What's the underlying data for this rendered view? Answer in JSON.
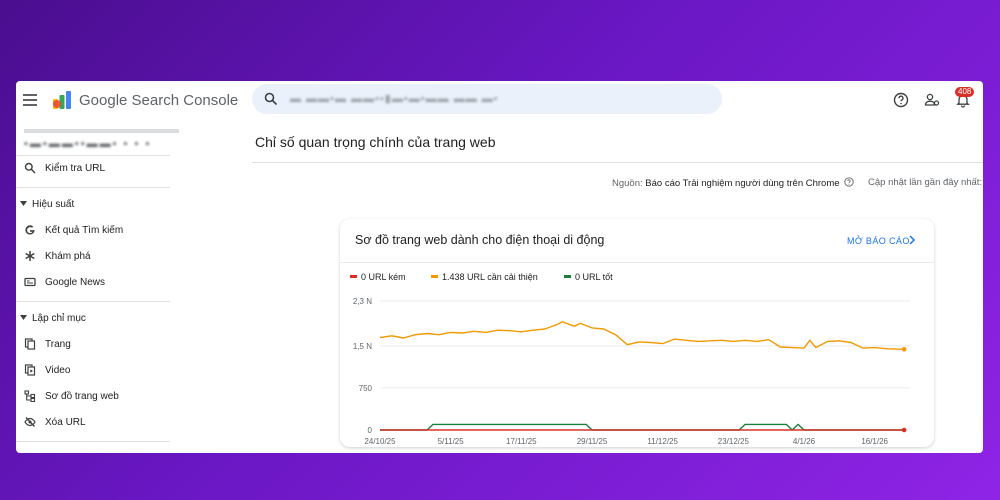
{
  "app": {
    "title": "Google Search Console",
    "search_value": "▬   ▬▬▪▬  ▬▬▪▪▮▬▪▬▪▬▬ ▬▬ ▬▪",
    "notification_count": "408"
  },
  "sidebar": {
    "site_name": "▪▬▪▬▬▪▪▬▬▪ ▪ ▪ ▪",
    "url_inspection": "Kiểm tra URL",
    "sections": {
      "performance": "Hiệu suất",
      "indexing": "Lập chỉ mục"
    },
    "items": {
      "search_results": "Kết quả Tìm kiếm",
      "discover": "Khám phá",
      "google_news": "Google News",
      "pages": "Trang",
      "video": "Video",
      "sitemaps": "Sơ đồ trang web",
      "removals": "Xóa URL"
    }
  },
  "main": {
    "page_title": "Chỉ số quan trọng chính của trang web",
    "source_label": "Nguồn:",
    "source_value": "Báo cáo Trải nghiệm người dùng trên Chrome",
    "updated_label": "Cập nhật lần gần đây nhất:"
  },
  "card": {
    "title": "Sơ đồ trang web dành cho điện thoại di động",
    "link": "MỞ BÁO CÁO"
  },
  "colors": {
    "poor": "#d93025",
    "needs_improvement": "#f29900",
    "good": "#188038",
    "accent": "#1a73e8"
  },
  "chart_data": {
    "type": "line",
    "x_ticks": [
      "24/10/25",
      "5/11/25",
      "17/11/25",
      "29/11/25",
      "11/12/25",
      "23/12/25",
      "4/1/26",
      "16/1/26"
    ],
    "y_ticks": [
      "0",
      "750",
      "1,5 N",
      "2,3 N"
    ],
    "ylim": [
      0,
      2300
    ],
    "x_range": [
      "2025-10-24",
      "2026-01-22"
    ],
    "legend": [
      "0 URL kém",
      "1.438 URL cần cải thiện",
      "0 URL tốt"
    ],
    "series": [
      {
        "name": "URL kém",
        "color": "#d93025",
        "points": [
          [
            "2025-10-24",
            0
          ],
          [
            "2026-01-21",
            0
          ]
        ]
      },
      {
        "name": "URL cần cải thiện",
        "color": "#f29900",
        "points": [
          [
            "2025-10-24",
            1650
          ],
          [
            "2025-10-26",
            1680
          ],
          [
            "2025-10-28",
            1640
          ],
          [
            "2025-10-30",
            1700
          ],
          [
            "2025-11-01",
            1720
          ],
          [
            "2025-11-03",
            1700
          ],
          [
            "2025-11-05",
            1740
          ],
          [
            "2025-11-07",
            1730
          ],
          [
            "2025-11-09",
            1760
          ],
          [
            "2025-11-11",
            1740
          ],
          [
            "2025-11-13",
            1780
          ],
          [
            "2025-11-15",
            1770
          ],
          [
            "2025-11-17",
            1750
          ],
          [
            "2025-11-19",
            1780
          ],
          [
            "2025-11-21",
            1800
          ],
          [
            "2025-11-23",
            1880
          ],
          [
            "2025-11-24",
            1930
          ],
          [
            "2025-11-26",
            1850
          ],
          [
            "2025-11-27",
            1900
          ],
          [
            "2025-11-29",
            1820
          ],
          [
            "2025-12-01",
            1800
          ],
          [
            "2025-12-03",
            1700
          ],
          [
            "2025-12-05",
            1520
          ],
          [
            "2025-12-07",
            1570
          ],
          [
            "2025-12-09",
            1560
          ],
          [
            "2025-12-11",
            1540
          ],
          [
            "2025-12-13",
            1620
          ],
          [
            "2025-12-15",
            1600
          ],
          [
            "2025-12-17",
            1580
          ],
          [
            "2025-12-19",
            1590
          ],
          [
            "2025-12-21",
            1600
          ],
          [
            "2025-12-23",
            1580
          ],
          [
            "2025-12-25",
            1600
          ],
          [
            "2025-12-27",
            1580
          ],
          [
            "2025-12-29",
            1610
          ],
          [
            "2025-12-31",
            1480
          ],
          [
            "2026-01-02",
            1470
          ],
          [
            "2026-01-04",
            1460
          ],
          [
            "2026-01-05",
            1600
          ],
          [
            "2026-01-06",
            1470
          ],
          [
            "2026-01-08",
            1580
          ],
          [
            "2026-01-10",
            1590
          ],
          [
            "2026-01-12",
            1560
          ],
          [
            "2026-01-14",
            1460
          ],
          [
            "2026-01-16",
            1470
          ],
          [
            "2026-01-18",
            1450
          ],
          [
            "2026-01-21",
            1438
          ]
        ]
      },
      {
        "name": "URL tốt",
        "color": "#188038",
        "points": [
          [
            "2025-10-24",
            0
          ],
          [
            "2025-11-01",
            0
          ],
          [
            "2025-11-02",
            100
          ],
          [
            "2025-11-28",
            100
          ],
          [
            "2025-11-29",
            0
          ],
          [
            "2025-12-24",
            0
          ],
          [
            "2025-12-25",
            100
          ],
          [
            "2026-01-01",
            100
          ],
          [
            "2026-01-02",
            0
          ],
          [
            "2026-01-03",
            100
          ],
          [
            "2026-01-04",
            0
          ],
          [
            "2026-01-21",
            0
          ]
        ]
      }
    ]
  }
}
